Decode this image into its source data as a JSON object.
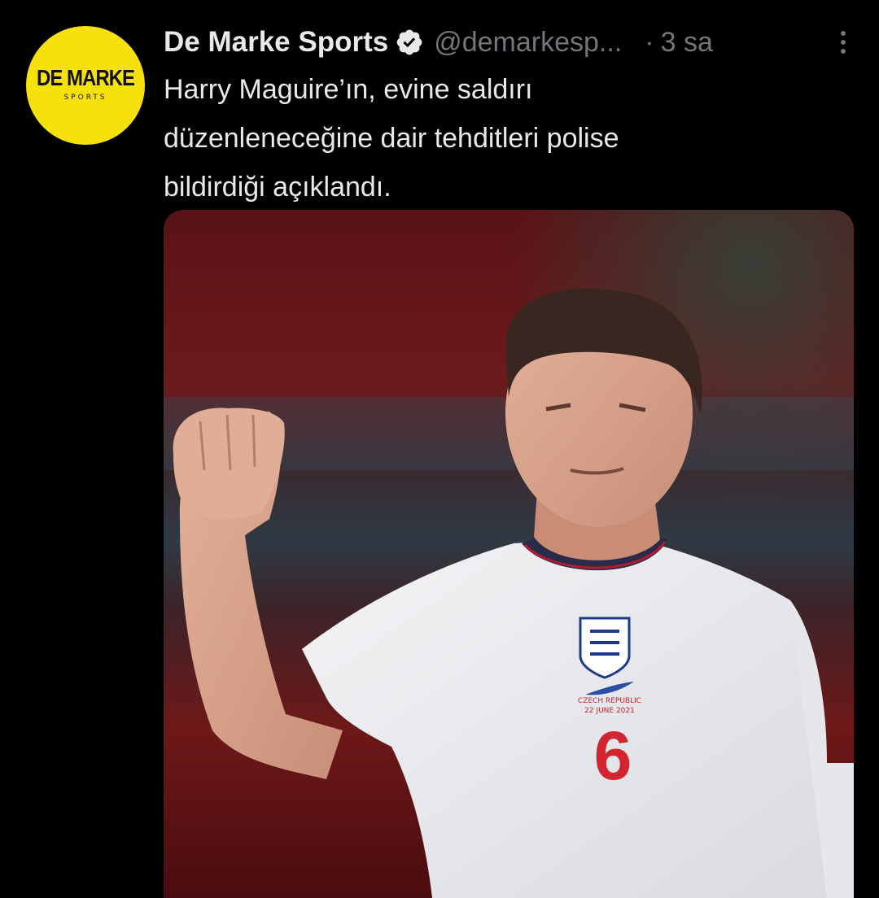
{
  "tweet": {
    "avatar": {
      "main": "DE MARKE",
      "sub": "SPORTS",
      "color": "#f7e10c"
    },
    "display_name": "De Marke Sports",
    "verified_icon": "verified-badge-icon",
    "handle": "@demarkesp...",
    "separator": "·",
    "time": "3 sa",
    "more_icon": "more-options-icon",
    "text": "Harry Maguire’ın, evine saldırı\ndüzenleneceğine dair tehditleri polise\nbildirdiği açıklandı.",
    "media": {
      "shirt_number": "6",
      "shirt_text_line1": "CZECH REPUBLIC",
      "shirt_text_line2": "22 JUNE 2021"
    }
  },
  "colors": {
    "background": "#000000",
    "primary_text": "#e7e9ea",
    "secondary_text": "#71767b",
    "avatar_yellow": "#f7e10c"
  }
}
